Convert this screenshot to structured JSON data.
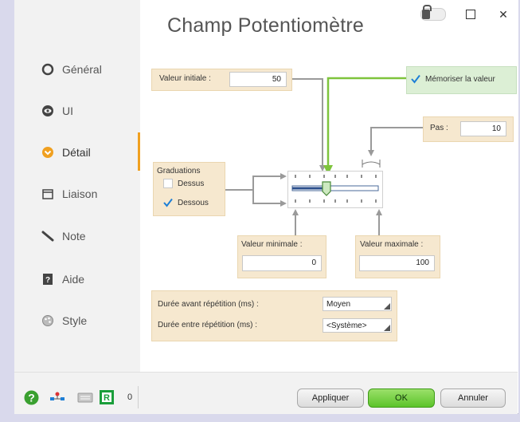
{
  "window": {
    "title": "Champ Potentiomètre",
    "minimize": "",
    "close": "✕"
  },
  "sidebar": {
    "items": [
      {
        "label": "Général",
        "icon": "general-icon"
      },
      {
        "label": "UI",
        "icon": "eye-icon"
      },
      {
        "label": "Détail",
        "icon": "detail-icon"
      },
      {
        "label": "Liaison",
        "icon": "link-icon"
      },
      {
        "label": "Note",
        "icon": "note-icon"
      },
      {
        "label": "Aide",
        "icon": "help-book-icon"
      },
      {
        "label": "Style",
        "icon": "style-icon"
      }
    ]
  },
  "detail": {
    "initial_value_label": "Valeur initiale :",
    "initial_value": "50",
    "remember_value_label": "Mémoriser la valeur",
    "remember_value_checked": true,
    "step_label": "Pas :",
    "step_value": "10",
    "graduations_label": "Graduations",
    "above_label": "Dessus",
    "above_checked": false,
    "below_label": "Dessous",
    "below_checked": true,
    "min_label": "Valeur minimale :",
    "min_value": "0",
    "max_label": "Valeur maximale :",
    "max_value": "100",
    "repeat_delay_label": "Durée avant répétition (ms) :",
    "repeat_delay_value": "Moyen",
    "repeat_interval_label": "Durée entre répétition (ms) :",
    "repeat_interval_value": "<Système>"
  },
  "bottom": {
    "counter": "0",
    "apply_label": "Appliquer",
    "ok_label": "OK",
    "cancel_label": "Annuler"
  },
  "colors": {
    "accent": "#f0a020",
    "panel": "#f6e8cf",
    "green_panel": "#dcefd5",
    "arrow_green": "#7ec43c",
    "arrow_gray": "#9a9a9a",
    "check_blue": "#1e7fd6"
  }
}
